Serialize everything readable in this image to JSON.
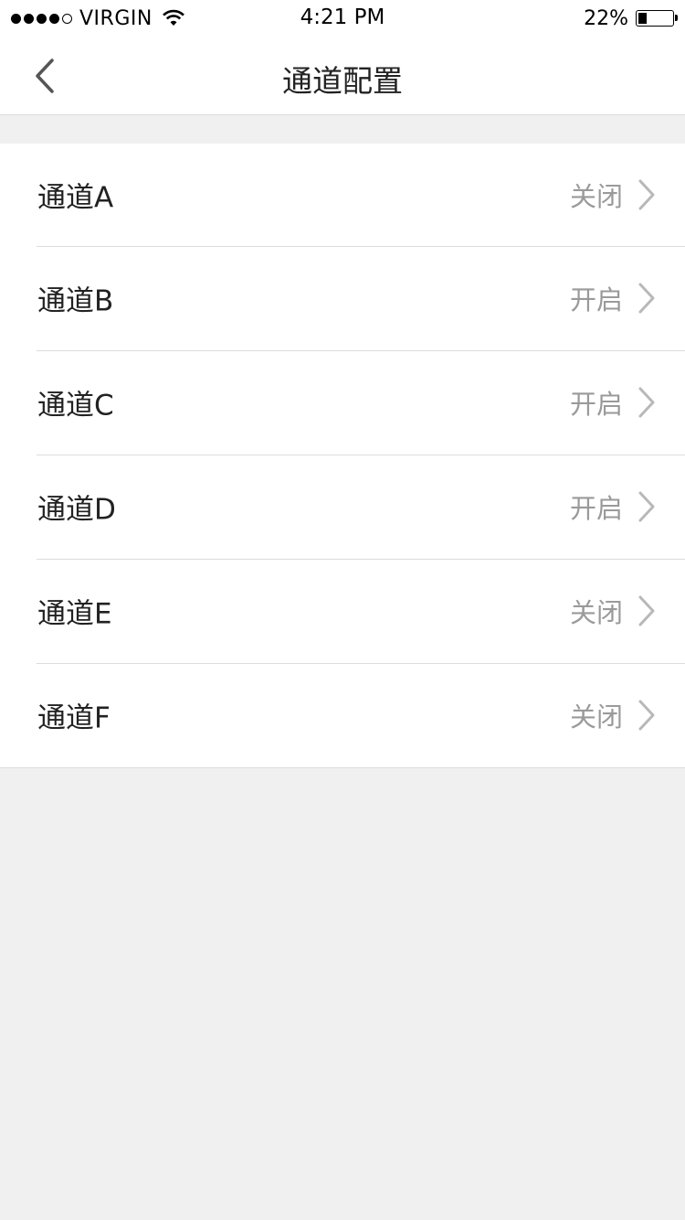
{
  "status_bar": {
    "carrier": "VIRGIN",
    "time": "4:21 PM",
    "battery_percent": "22%",
    "battery_level": 0.22,
    "signal_bars": 4,
    "signal_total": 5,
    "icons": [
      "signal-dots-icon",
      "wifi-icon",
      "battery-icon"
    ]
  },
  "nav": {
    "title": "通道配置",
    "back_icon": "chevron-left-icon"
  },
  "channels": [
    {
      "label": "通道A",
      "status": "关闭"
    },
    {
      "label": "通道B",
      "status": "开启"
    },
    {
      "label": "通道C",
      "status": "开启"
    },
    {
      "label": "通道D",
      "status": "开启"
    },
    {
      "label": "通道E",
      "status": "关闭"
    },
    {
      "label": "通道F",
      "status": "关闭"
    }
  ],
  "colors": {
    "background": "#f0f0f0",
    "surface": "#ffffff",
    "divider": "#dcdcdc",
    "text_primary": "#222222",
    "text_secondary": "#9a9a9a",
    "chevron": "#b8b8b8"
  }
}
